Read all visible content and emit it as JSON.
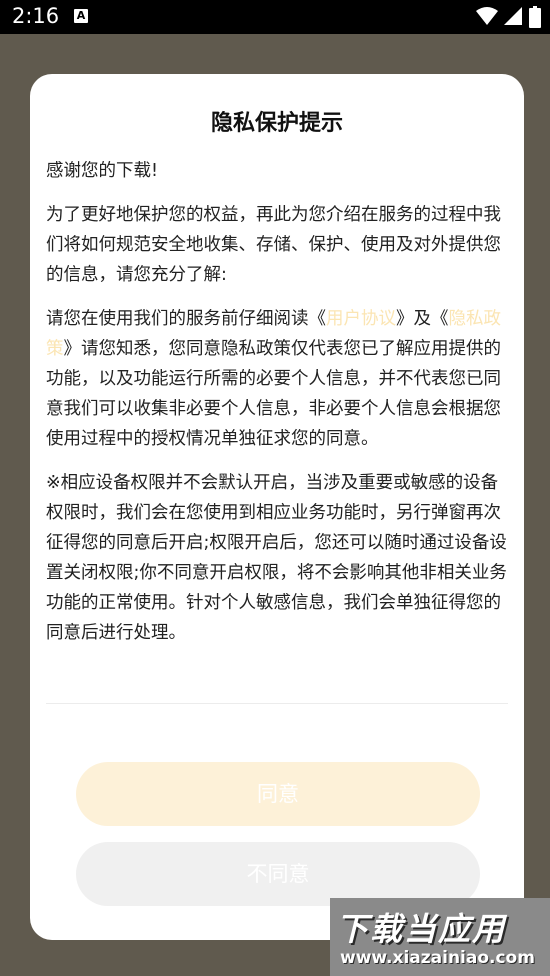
{
  "status_bar": {
    "time": "2:16",
    "notification_glyph": "A",
    "icons": [
      "wifi-icon",
      "signal-icon",
      "battery-icon"
    ]
  },
  "dialog": {
    "title": "隐私保护提示",
    "para1": "感谢您的下载!",
    "para2": "为了更好地保护您的权益，再此为您介绍在服务的过程中我们将如何规范安全地收集、存储、保护、使用及对外提供您的信息，请您充分了解:",
    "para3": {
      "prefix": "请您在使用我们的服务前仔细阅读《",
      "user_agreement_link": "用户协议",
      "middle": "》及《",
      "privacy_policy_link": "隐私政策",
      "suffix": "》请您知悉，您同意隐私政策仅代表您已了解应用提供的功能，以及功能运行所需的必要个人信息，并不代表您已同意我们可以收集非必要个人信息，非必要个人信息会根据您使用过程中的授权情况单独征求您的同意。"
    },
    "para4": "※相应设备权限并不会默认开启，当涉及重要或敏感的设备权限时，我们会在您使用到相应业务功能时，另行弹窗再次征得您的同意后开启;权限开启后，您还可以随时通过设备设置关闭权限;你不同意开启权限，将不会影响其他非相关业务功能的正常使用。针对个人敏感信息，我们会单独征得您的同意后进行处理。",
    "agree_label": "同意",
    "disagree_label": "不同意"
  },
  "watermark": {
    "brand": "下载当应用",
    "url": "www.xiazainiao.com"
  },
  "colors": {
    "link": "#fbe5b3",
    "agree_button": "#fdf1d8",
    "disagree_button": "#f0f0f0",
    "scrim": "#605a4e"
  }
}
